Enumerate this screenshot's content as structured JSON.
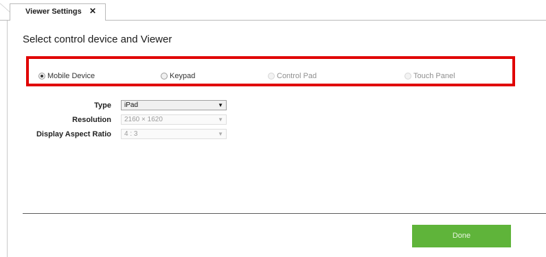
{
  "tab": {
    "title": "Viewer Settings",
    "close": "✕"
  },
  "heading": "Select control device and Viewer",
  "device_options": [
    {
      "label": "Mobile Device",
      "selected": true,
      "enabled": true
    },
    {
      "label": "Keypad",
      "selected": false,
      "enabled": true
    },
    {
      "label": "Control Pad",
      "selected": false,
      "enabled": false
    },
    {
      "label": "Touch Panel",
      "selected": false,
      "enabled": false
    }
  ],
  "fields": {
    "type": {
      "label": "Type",
      "value": "iPad"
    },
    "resolution": {
      "label": "Resolution",
      "value": "2160 × 1620"
    },
    "aspect_ratio": {
      "label": "Display Aspect Ratio",
      "value": "4 : 3"
    }
  },
  "done_label": "Done",
  "colors": {
    "highlight": "#e00000",
    "done_button": "#5fb43a"
  }
}
